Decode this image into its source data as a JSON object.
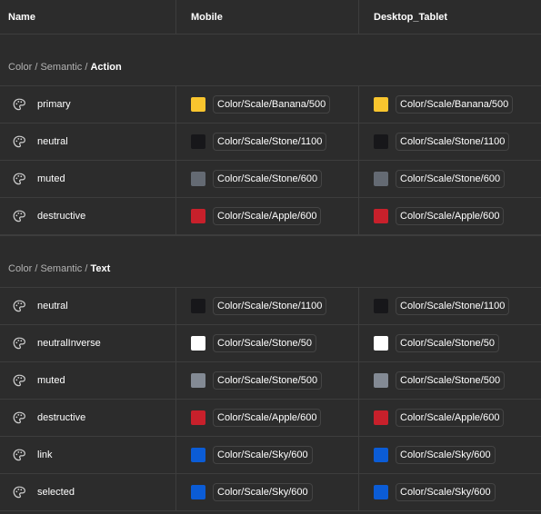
{
  "header": {
    "name": "Name",
    "mobile": "Mobile",
    "desktop": "Desktop_Tablet"
  },
  "groups": [
    {
      "path_prefix": "Color / Semantic / ",
      "leaf": "Action",
      "rows": [
        {
          "name": "primary",
          "mobile": {
            "label": "Color/Scale/Banana/500",
            "color": "#f9c52e"
          },
          "desktop": {
            "label": "Color/Scale/Banana/500",
            "color": "#f9c52e"
          }
        },
        {
          "name": "neutral",
          "mobile": {
            "label": "Color/Scale/Stone/1100",
            "color": "#17171a"
          },
          "desktop": {
            "label": "Color/Scale/Stone/1100",
            "color": "#17171a"
          }
        },
        {
          "name": "muted",
          "mobile": {
            "label": "Color/Scale/Stone/600",
            "color": "#646a73"
          },
          "desktop": {
            "label": "Color/Scale/Stone/600",
            "color": "#646a73"
          }
        },
        {
          "name": "destructive",
          "mobile": {
            "label": "Color/Scale/Apple/600",
            "color": "#c8202b"
          },
          "desktop": {
            "label": "Color/Scale/Apple/600",
            "color": "#c8202b"
          }
        }
      ]
    },
    {
      "path_prefix": "Color / Semantic / ",
      "leaf": "Text",
      "rows": [
        {
          "name": "neutral",
          "mobile": {
            "label": "Color/Scale/Stone/1100",
            "color": "#17171a"
          },
          "desktop": {
            "label": "Color/Scale/Stone/1100",
            "color": "#17171a"
          }
        },
        {
          "name": "neutralInverse",
          "mobile": {
            "label": "Color/Scale/Stone/50",
            "color": "#ffffff"
          },
          "desktop": {
            "label": "Color/Scale/Stone/50",
            "color": "#ffffff"
          }
        },
        {
          "name": "muted",
          "mobile": {
            "label": "Color/Scale/Stone/500",
            "color": "#838a94"
          },
          "desktop": {
            "label": "Color/Scale/Stone/500",
            "color": "#838a94"
          }
        },
        {
          "name": "destructive",
          "mobile": {
            "label": "Color/Scale/Apple/600",
            "color": "#c8202b"
          },
          "desktop": {
            "label": "Color/Scale/Apple/600",
            "color": "#c8202b"
          }
        },
        {
          "name": "link",
          "mobile": {
            "label": "Color/Scale/Sky/600",
            "color": "#0b5cd6"
          },
          "desktop": {
            "label": "Color/Scale/Sky/600",
            "color": "#0b5cd6"
          }
        },
        {
          "name": "selected",
          "mobile": {
            "label": "Color/Scale/Sky/600",
            "color": "#0b5cd6"
          },
          "desktop": {
            "label": "Color/Scale/Sky/600",
            "color": "#0b5cd6"
          }
        }
      ]
    }
  ],
  "icons": {
    "row_icon": "palette-icon"
  }
}
